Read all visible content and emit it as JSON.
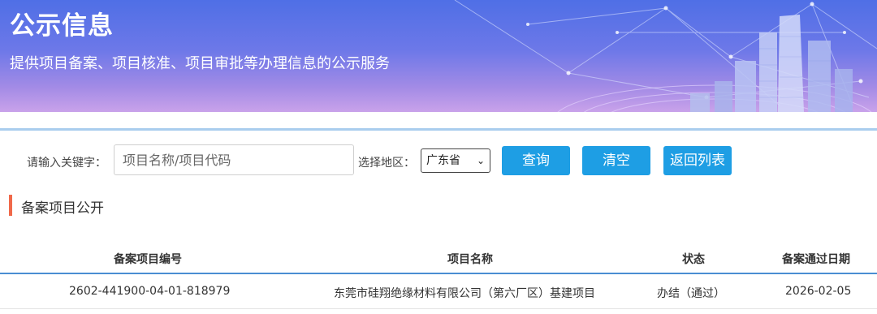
{
  "banner": {
    "title": "公示信息",
    "subtitle": "提供项目备案、项目核准、项目审批等办理信息的公示服务"
  },
  "search": {
    "keyword_label": "请输入关键字：",
    "keyword_placeholder": "项目名称/项目代码",
    "region_label": "选择地区：",
    "region_value": "广东省",
    "query_button": "查询",
    "clear_button": "清空",
    "back_button": "返回列表"
  },
  "section": {
    "title": "备案项目公开"
  },
  "table": {
    "headers": [
      "备案项目编号",
      "项目名称",
      "状态",
      "备案通过日期"
    ],
    "rows": [
      [
        "2602-441900-04-01-818979",
        "东莞市硅翔绝缘材料有限公司（第六厂区）基建项目",
        "办结（通过）",
        "2026-02-05"
      ]
    ]
  },
  "colors": {
    "accent": "#1e9ee4",
    "section_marker": "#f0694a",
    "header_line": "#4a8ed2"
  }
}
